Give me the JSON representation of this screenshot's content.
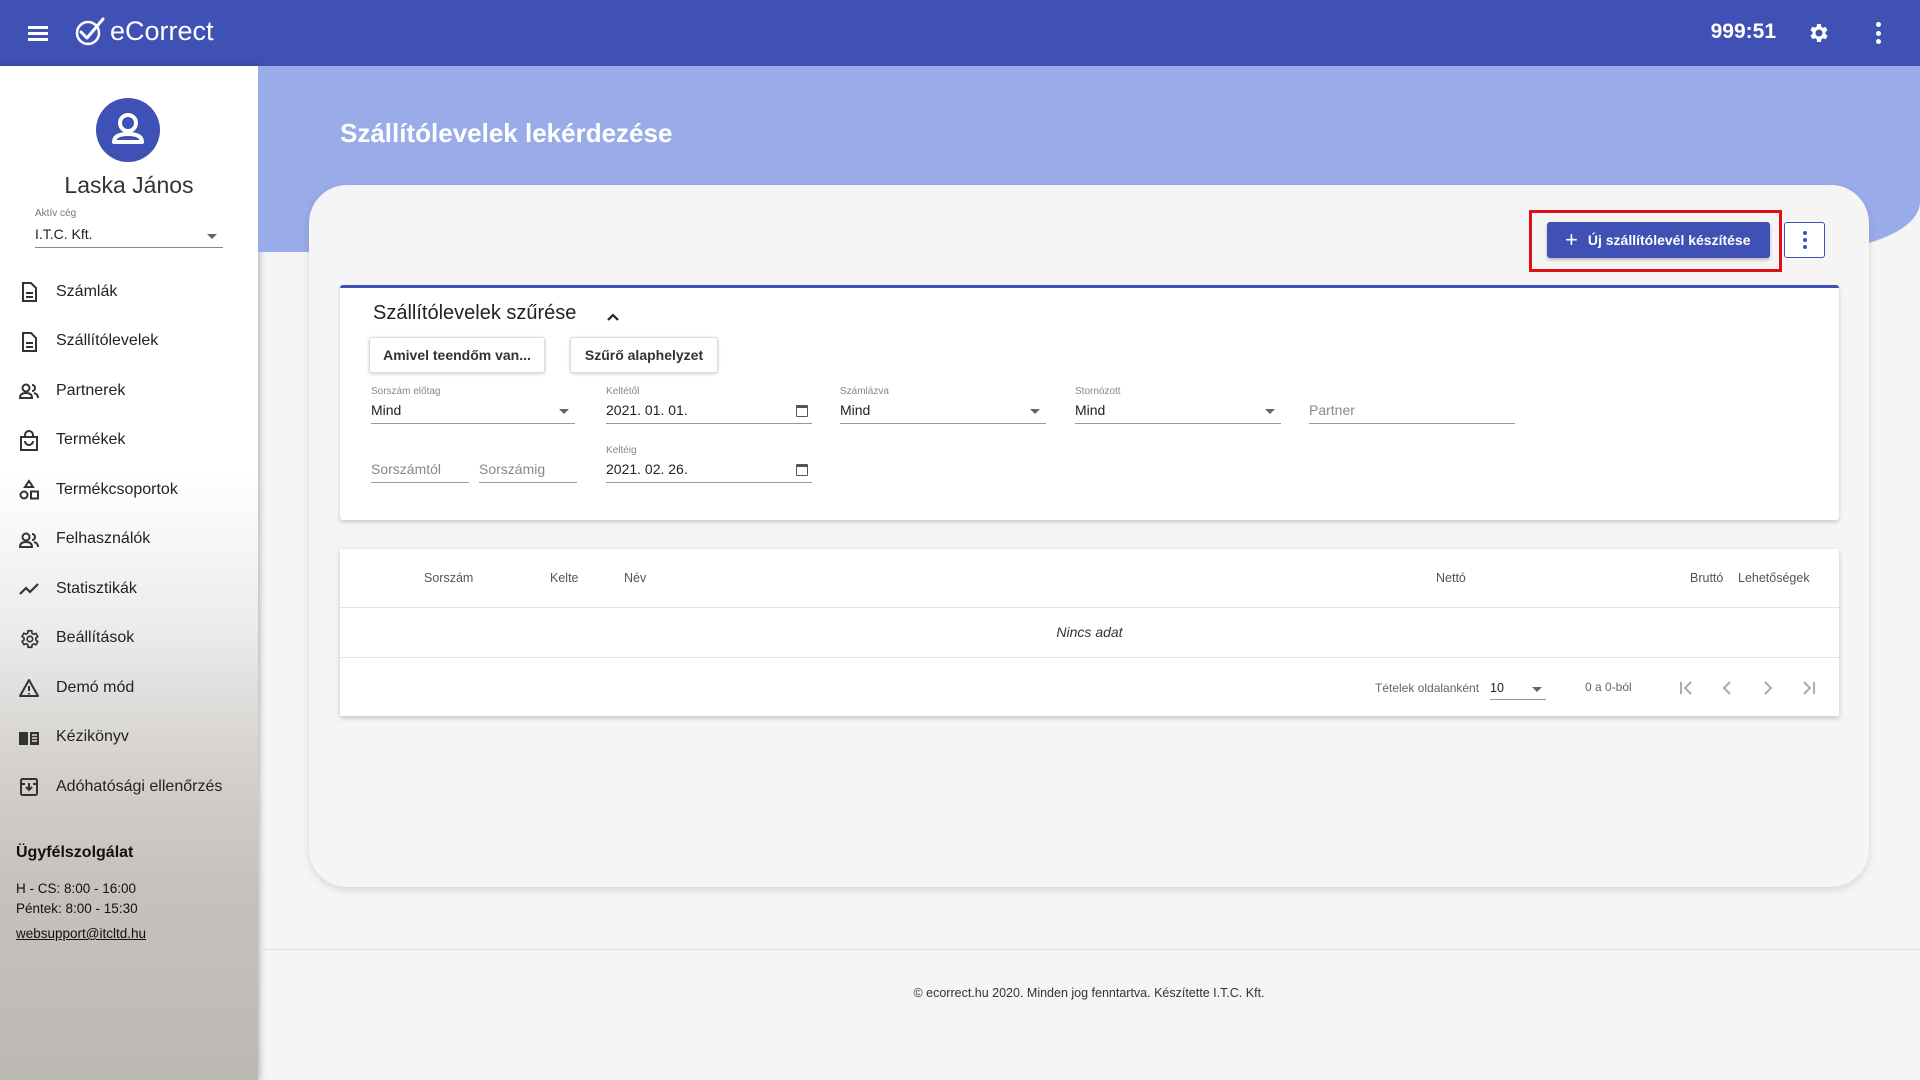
{
  "app": {
    "name": "eCorrect",
    "timer": "999:51"
  },
  "colors": {
    "primary": "#3f51b5",
    "hero": "#9aabea",
    "highlight": "#e0101a"
  },
  "sidebar": {
    "user_name": "Laska János",
    "company_label": "Aktív cég",
    "company_value": "I.T.C. Kft.",
    "items": [
      {
        "label": "Számlák",
        "icon": "document-icon"
      },
      {
        "label": "Szállítólevelek",
        "icon": "document-icon"
      },
      {
        "label": "Partnerek",
        "icon": "people-icon"
      },
      {
        "label": "Termékek",
        "icon": "shopping-bag-icon"
      },
      {
        "label": "Termékcsoportok",
        "icon": "category-icon"
      },
      {
        "label": "Felhasználók",
        "icon": "people-icon"
      },
      {
        "label": "Statisztikák",
        "icon": "trending-icon"
      },
      {
        "label": "Beállítások",
        "icon": "gear-icon"
      },
      {
        "label": "Demó mód",
        "icon": "warning-icon"
      },
      {
        "label": "Kézikönyv",
        "icon": "book-icon"
      },
      {
        "label": "Adóhatósági ellenőrzés",
        "icon": "archive-icon"
      }
    ],
    "support": {
      "title": "Ügyfélszolgálat",
      "hours1": "H - CS: 8:00 - 16:00",
      "hours2": "Péntek: 8:00 - 15:30",
      "email": "websupport@itcltd.hu"
    }
  },
  "page": {
    "title": "Szállítólevelek lekérdezése",
    "new_button": "Új szállítólevél készítése"
  },
  "filter": {
    "title": "Szállítólevelek szűrése",
    "btn_todo": "Amivel teendőm van...",
    "btn_reset": "Szűrő alaphelyzet",
    "prefix_label": "Sorszám előtag",
    "prefix_value": "Mind",
    "date_from_label": "Keltétől",
    "date_from_value": "2021. 01. 01.",
    "invoiced_label": "Számlázva",
    "invoiced_value": "Mind",
    "cancelled_label": "Stornózott",
    "cancelled_value": "Mind",
    "partner_placeholder": "Partner",
    "num_from_placeholder": "Sorszámtól",
    "num_to_placeholder": "Sorszámig",
    "date_to_label": "Keltéig",
    "date_to_value": "2021. 02. 26."
  },
  "table": {
    "headers": {
      "number": "Sorszám",
      "date": "Kelte",
      "name": "Név",
      "net": "Nettó",
      "gross": "Bruttó",
      "options": "Lehetőségek"
    },
    "empty": "Nincs adat",
    "per_page_label": "Tételek oldalanként",
    "per_page_value": "10",
    "range": "0 a 0-ból"
  },
  "footer": {
    "text": "© ecorrect.hu 2020. Minden jog fenntartva. Készítette I.T.C. Kft."
  }
}
